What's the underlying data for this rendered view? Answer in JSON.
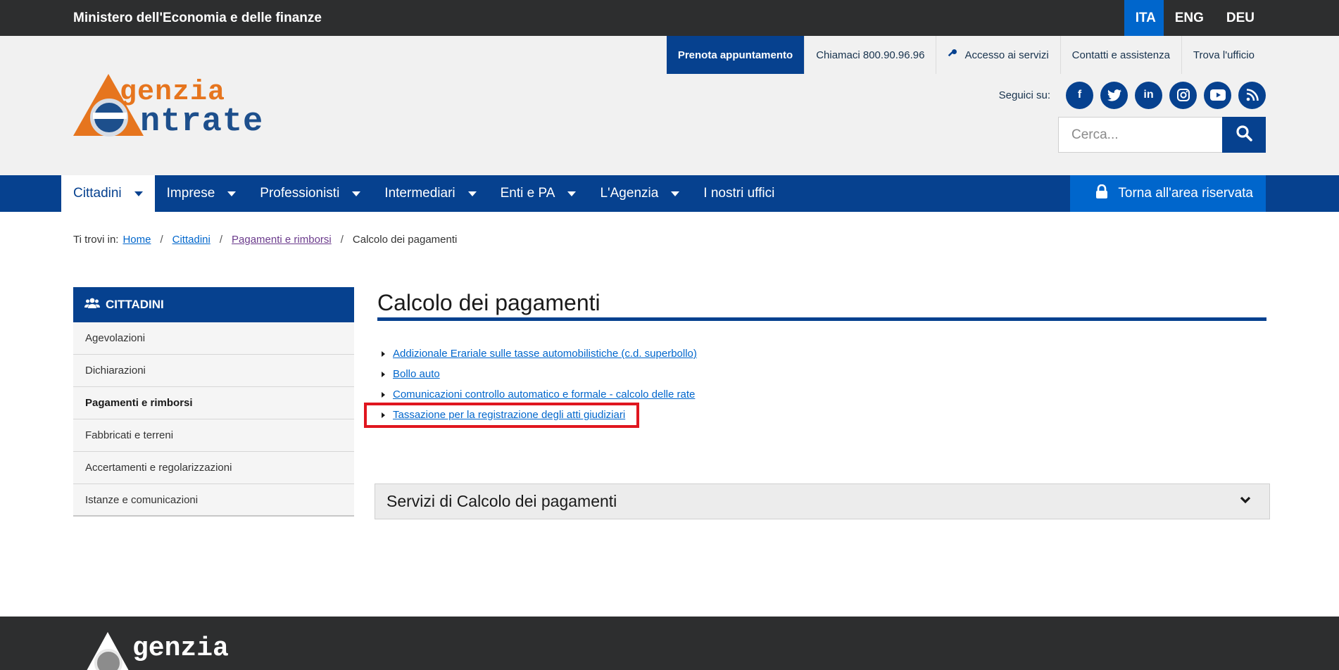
{
  "topbar": {
    "ministry": "Ministero dell'Economia e delle finanze",
    "languages": [
      "ITA",
      "ENG",
      "DEU"
    ],
    "active_language": "ITA"
  },
  "logo": {
    "line1": "genzia",
    "line2": "ntrate",
    "alt": "Agenzia Entrate"
  },
  "utility_nav": {
    "book": "Prenota appuntamento",
    "call": "Chiamaci 800.90.96.96",
    "access": "Accesso ai servizi",
    "contacts": "Contatti e assistenza",
    "office": "Trova l'ufficio"
  },
  "social": {
    "label": "Seguici su:",
    "icons": [
      "facebook-icon",
      "twitter-icon",
      "linkedin-icon",
      "instagram-icon",
      "youtube-icon",
      "rss-icon"
    ]
  },
  "search": {
    "placeholder": "Cerca..."
  },
  "main_nav": {
    "items": [
      "Cittadini",
      "Imprese",
      "Professionisti",
      "Intermediari",
      "Enti e PA",
      "L'Agenzia",
      "I nostri uffici"
    ],
    "reserved": "Torna all'area riservata"
  },
  "breadcrumb": {
    "prefix": "Ti trovi in:",
    "items": [
      "Home",
      "Cittadini",
      "Pagamenti e rimborsi"
    ],
    "current": "Calcolo dei pagamenti"
  },
  "sidebar": {
    "title": "CITTADINI",
    "items": [
      "Agevolazioni",
      "Dichiarazioni",
      "Pagamenti e rimborsi",
      "Fabbricati e terreni",
      "Accertamenti e regolarizzazioni",
      "Istanze e comunicazioni"
    ],
    "active": "Pagamenti e rimborsi"
  },
  "content": {
    "title": "Calcolo dei pagamenti",
    "links": [
      "Addizionale Erariale sulle tasse automobilistiche (c.d. superbollo)",
      "Bollo auto",
      "Comunicazioni controllo automatico e formale - calcolo delle rate",
      "Tassazione per la registrazione degli atti giudiziari"
    ],
    "accordion": "Servizi di Calcolo dei pagamenti"
  },
  "footer": {
    "logo_text": "genzia"
  },
  "colors": {
    "brand_blue": "#06418f",
    "accent_blue": "#0066cc",
    "dark": "#2d2e2f",
    "highlight": "#e0161f",
    "orange": "#e6751e"
  }
}
